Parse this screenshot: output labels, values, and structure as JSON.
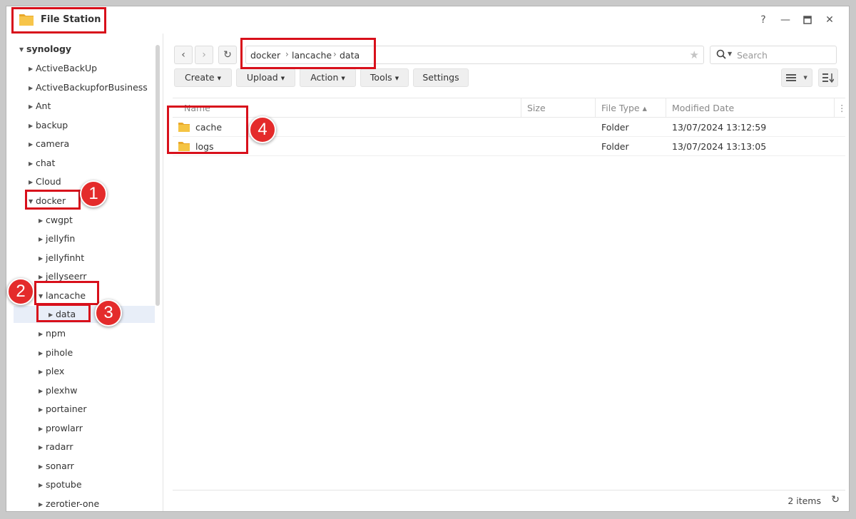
{
  "window": {
    "title": "File Station",
    "help": "?",
    "minimize": "—",
    "maximize": "□",
    "close": "✕"
  },
  "sidebar": {
    "root": "synology",
    "items": [
      {
        "label": "ActiveBackUp"
      },
      {
        "label": "ActiveBackupforBusiness"
      },
      {
        "label": "Ant"
      },
      {
        "label": "backup"
      },
      {
        "label": "camera"
      },
      {
        "label": "chat"
      },
      {
        "label": "Cloud"
      },
      {
        "label": "docker"
      },
      {
        "label": "cwgpt"
      },
      {
        "label": "jellyfin"
      },
      {
        "label": "jellyfinht"
      },
      {
        "label": "jellyseerr"
      },
      {
        "label": "lancache"
      },
      {
        "label": "data"
      },
      {
        "label": "npm"
      },
      {
        "label": "pihole"
      },
      {
        "label": "plex"
      },
      {
        "label": "plexhw"
      },
      {
        "label": "portainer"
      },
      {
        "label": "prowlarr"
      },
      {
        "label": "radarr"
      },
      {
        "label": "sonarr"
      },
      {
        "label": "spotube"
      },
      {
        "label": "zerotier-one"
      }
    ]
  },
  "nav": {
    "back": "‹",
    "forward": "›",
    "refresh": "↻",
    "breadcrumb": [
      "docker",
      "lancache",
      "data"
    ],
    "separator": "›",
    "star": "★",
    "search_placeholder": "Search"
  },
  "toolbar": {
    "create": "Create",
    "upload": "Upload",
    "action": "Action",
    "tools": "Tools",
    "settings": "Settings"
  },
  "table": {
    "columns": [
      "Name",
      "Size",
      "File Type ▴",
      "Modified Date"
    ],
    "more": "⋮",
    "rows": [
      {
        "name": "cache",
        "size": "",
        "type": "Folder",
        "modified": "13/07/2024 13:12:59"
      },
      {
        "name": "logs",
        "size": "",
        "type": "Folder",
        "modified": "13/07/2024 13:13:05"
      }
    ]
  },
  "footer": {
    "count": "2 items",
    "refresh": "↻"
  },
  "annotations": [
    "1",
    "2",
    "3",
    "4"
  ],
  "colors": {
    "annotation_red": "#d8101b",
    "badge_red": "#e42b2b",
    "folder_yellow": "#f5c443",
    "selected_bg": "#e8eef8"
  }
}
